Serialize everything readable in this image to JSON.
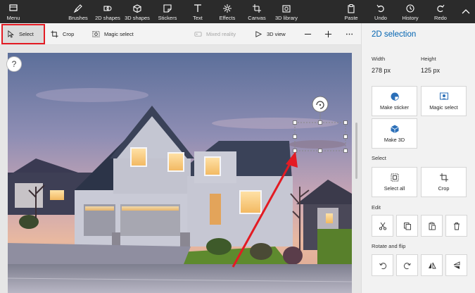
{
  "ribbon": {
    "menu": "Menu",
    "brushes": "Brushes",
    "shapes2d": "2D shapes",
    "shapes3d": "3D shapes",
    "stickers": "Stickers",
    "text": "Text",
    "effects": "Effects",
    "canvas": "Canvas",
    "library3d": "3D library",
    "paste": "Paste",
    "undo": "Undo",
    "history": "History",
    "redo": "Redo"
  },
  "toolbar": {
    "select": "Select",
    "crop": "Crop",
    "magic_select": "Magic select",
    "mixed_reality": "Mixed reality",
    "view3d": "3D view"
  },
  "help_label": "?",
  "panel": {
    "title": "2D selection",
    "width_label": "Width",
    "height_label": "Height",
    "width_value": "278 px",
    "height_value": "125 px",
    "make_sticker": "Make sticker",
    "magic_select": "Magic select",
    "make3d": "Make 3D",
    "select_section": "Select",
    "select_all": "Select all",
    "crop": "Crop",
    "edit_section": "Edit",
    "rotate_section": "Rotate and flip"
  },
  "colors": {
    "accent": "#0063b1",
    "highlight_box": "#e31b23",
    "arrow": "#e31b23",
    "ribbon_bg": "#2b2b2b"
  }
}
